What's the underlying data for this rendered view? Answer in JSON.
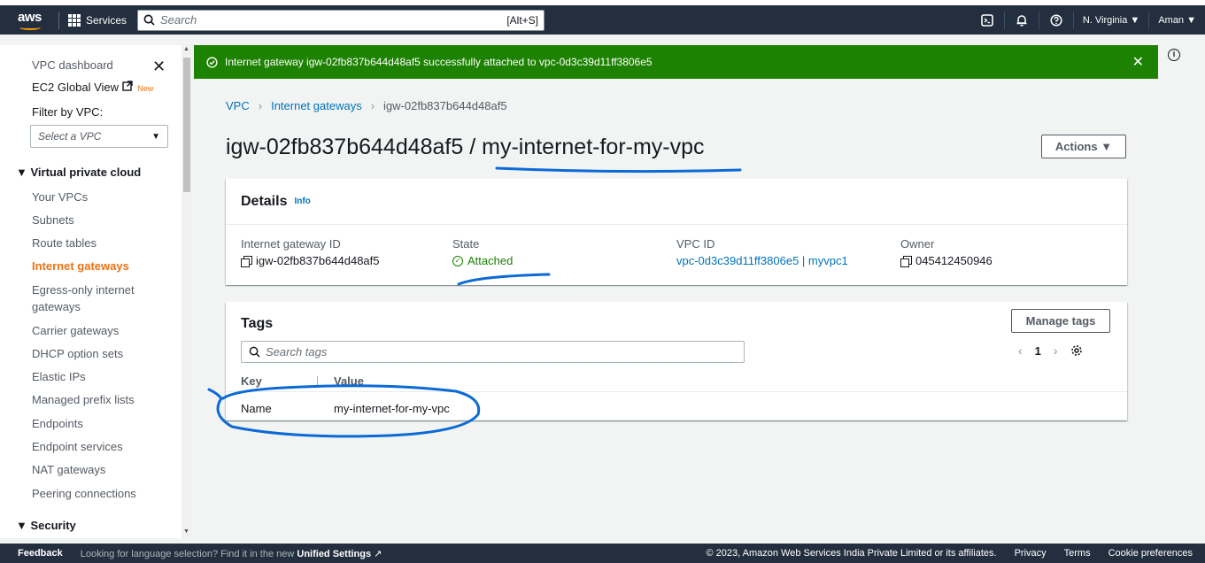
{
  "topbar": {
    "logo": "aws",
    "services": "Services",
    "search_placeholder": "Search",
    "search_shortcut": "[Alt+S]",
    "region": "N. Virginia ▼",
    "user": "Aman ▼"
  },
  "sidebar": {
    "dashboard": "VPC dashboard",
    "ec2_global": "EC2 Global View",
    "new_badge": "New",
    "filter_label": "Filter by VPC:",
    "select_placeholder": "Select a VPC",
    "section_vpc": "▼ Virtual private cloud",
    "items": [
      "Your VPCs",
      "Subnets",
      "Route tables",
      "Internet gateways",
      "Egress-only internet",
      "gateways",
      "Carrier gateways",
      "DHCP option sets",
      "Elastic IPs",
      "Managed prefix lists",
      "Endpoints",
      "Endpoint services",
      "NAT gateways",
      "Peering connections"
    ],
    "section_security": "▼ Security"
  },
  "flash": {
    "message": "Internet gateway igw-02fb837b644d48af5 successfully attached to vpc-0d3c39d11ff3806e5",
    "color": "#1d8102"
  },
  "breadcrumb": {
    "vpc": "VPC",
    "igw": "Internet gateways",
    "current": "igw-02fb837b644d48af5"
  },
  "page": {
    "title": "igw-02fb837b644d48af5 / my-internet-for-my-vpc",
    "actions": "Actions ▼"
  },
  "details": {
    "heading": "Details",
    "info": "Info",
    "igw_label": "Internet gateway ID",
    "igw_value": "igw-02fb837b644d48af5",
    "state_label": "State",
    "state_value": "Attached",
    "vpc_label": "VPC ID",
    "vpc_value": "vpc-0d3c39d11ff3806e5 | myvpc1",
    "owner_label": "Owner",
    "owner_value": "045412450946"
  },
  "tags": {
    "heading": "Tags",
    "manage": "Manage tags",
    "search_placeholder": "Search tags",
    "page": "1",
    "col_key": "Key",
    "col_value": "Value",
    "rows": [
      {
        "key": "Name",
        "value": "my-internet-for-my-vpc"
      }
    ]
  },
  "footer": {
    "feedback": "Feedback",
    "lang_text": "Looking for language selection? Find it in the new",
    "lang_link": "Unified Settings",
    "copyright": "© 2023, Amazon Web Services India Private Limited or its affiliates.",
    "privacy": "Privacy",
    "terms": "Terms",
    "cookies": "Cookie preferences"
  },
  "colors": {
    "nav": "#232f3e",
    "accent": "#ec7211",
    "link": "#0073bb",
    "annotation": "#0b6ad6"
  }
}
